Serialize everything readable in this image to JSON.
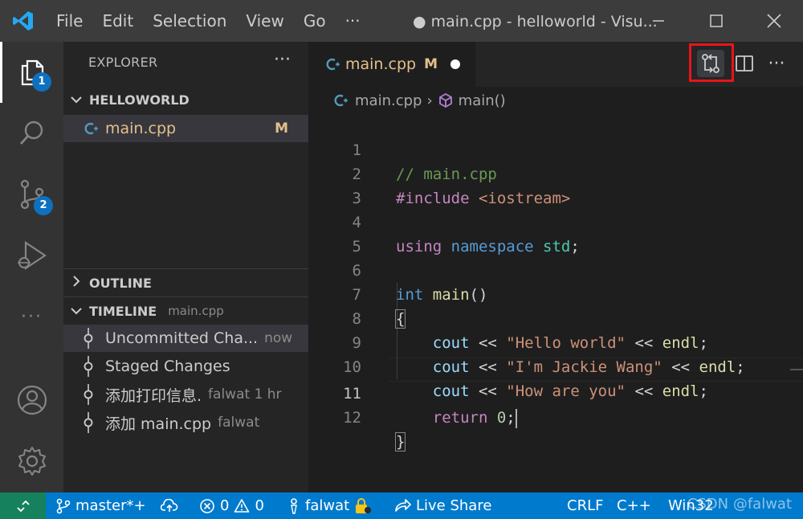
{
  "titlebar": {
    "menu": [
      "File",
      "Edit",
      "Selection",
      "View",
      "Go",
      "···"
    ],
    "title": "● main.cpp - helloworld - Visu..."
  },
  "activity": {
    "explorer_badge": "1",
    "scm_badge": "2"
  },
  "sidebar": {
    "title": "EXPLORER",
    "more": "···",
    "folder": "HELLOWORLD",
    "file": {
      "name": "main.cpp",
      "status": "M"
    },
    "outline": "OUTLINE",
    "timeline": {
      "title": "TIMELINE",
      "subtitle": "main.cpp",
      "items": [
        {
          "label": "Uncommitted Cha...",
          "meta": "now"
        },
        {
          "label": "Staged Changes",
          "meta": ""
        },
        {
          "label": "添加打印信息.",
          "meta": "falwat 1 hr"
        },
        {
          "label": "添加 main.cpp",
          "meta": "falwat"
        }
      ]
    }
  },
  "editor": {
    "tab": {
      "label": "main.cpp",
      "status": "M"
    },
    "more": "···",
    "breadcrumb": {
      "file": "main.cpp",
      "sep": "›",
      "symbol": "main()"
    },
    "line_numbers": [
      "1",
      "2",
      "3",
      "4",
      "5",
      "6",
      "7",
      "8",
      "9",
      "10",
      "11",
      "12"
    ],
    "code": {
      "l1": "// main.cpp",
      "l2_pre": "#include",
      "l2_inc": " <iostream>",
      "l4_kw": "using",
      "l4_ns": " namespace",
      "l4_std": " std",
      "l4_semi": ";",
      "l6_int": "int",
      "l6_fn": " main",
      "l6_paren": "()",
      "l7": "{",
      "cout": "    cout",
      "op": " << ",
      "s8": "\"Hello world\"",
      "s9": "\"I'm Jackie Wang\"",
      "s10": "\"How are you\"",
      "endl": "endl",
      "semi": ";",
      "l11_ret": "    return",
      "l11_num": " 0",
      "l11_semi": ";",
      "l12": "}"
    }
  },
  "statusbar": {
    "branch": "master*+",
    "errors": "0",
    "warnings": "0",
    "user": "falwat",
    "live_share": "Live Share",
    "eol": "CRLF",
    "language": "C++",
    "platform": "Win32",
    "watermark": "CSDN @falwat"
  },
  "colors": {
    "accent": "#007acc",
    "modified": "#e2c08d",
    "highlight": "#e8141a"
  }
}
